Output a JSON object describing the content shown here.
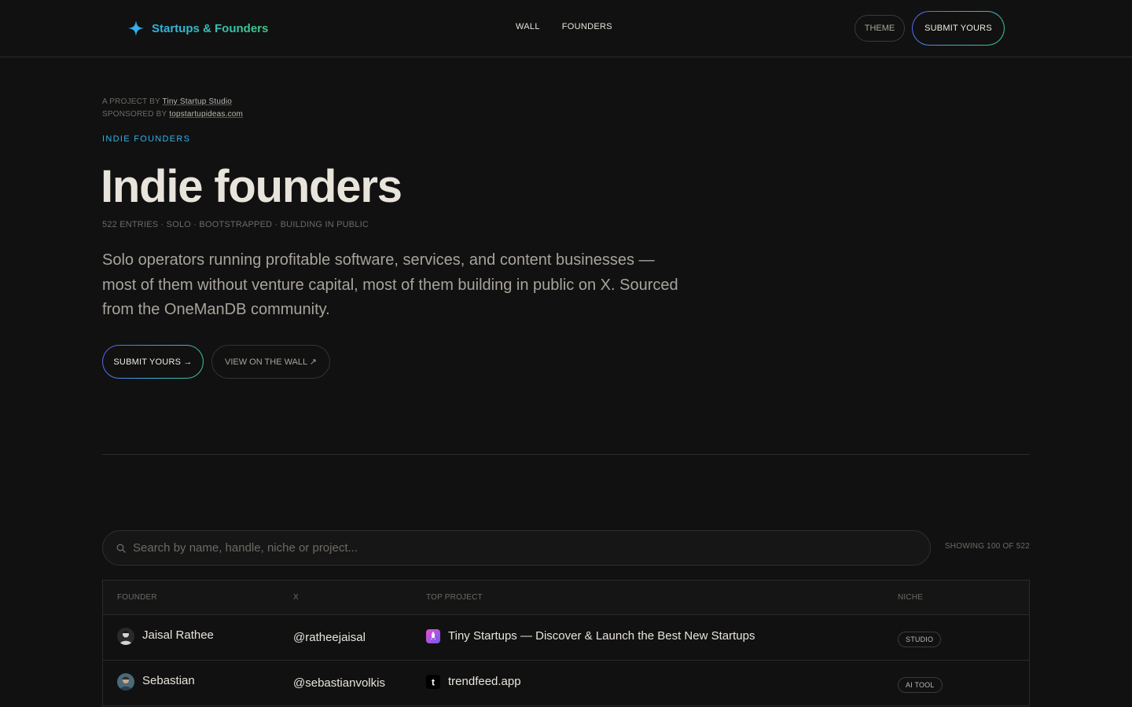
{
  "brand": {
    "name": "Startups & Founders",
    "icon": "sparkle-icon",
    "accent": "#2fb3e8",
    "accent2": "#3ec98a"
  },
  "nav": {
    "links": [
      "WALL",
      "FOUNDERS"
    ],
    "theme_label": "THEME",
    "submit_label": "SUBMIT YOURS"
  },
  "credits": {
    "project_prefix": "A PROJECT BY",
    "project_name": "Tiny Startup Studio",
    "sponsor_prefix": "SPONSORED BY",
    "sponsor_name": "topstartupideas.com"
  },
  "hero": {
    "eyebrow": "INDIE FOUNDERS",
    "title": "Indie founders",
    "meta": "522 ENTRIES · SOLO · BOOTSTRAPPED · BUILDING IN PUBLIC",
    "description": "Solo operators running profitable software, services, and content businesses — most of them without venture capital, most of them building in public on X. Sourced from the OneManDB community.",
    "submit_label": "SUBMIT YOURS →",
    "wall_label": "VIEW ON THE WALL ↗"
  },
  "search": {
    "placeholder": "Search by name, handle, niche or project...",
    "value": "",
    "showing": "SHOWING 100 OF 522"
  },
  "table": {
    "headers": [
      "FOUNDER",
      "X",
      "TOP PROJECT",
      "NICHE"
    ],
    "rows": [
      {
        "founder": "Jaisal Rathee",
        "handle": "@ratheejaisal",
        "project": "Tiny Startups — Discover & Launch the Best New Startups",
        "project_icon": "rocket-icon",
        "niche": "STUDIO"
      },
      {
        "founder": "Sebastian",
        "handle": "@sebastianvolkis",
        "project": "trendfeed.app",
        "project_icon": "t-letter-icon",
        "niche": "AI TOOL"
      }
    ]
  }
}
